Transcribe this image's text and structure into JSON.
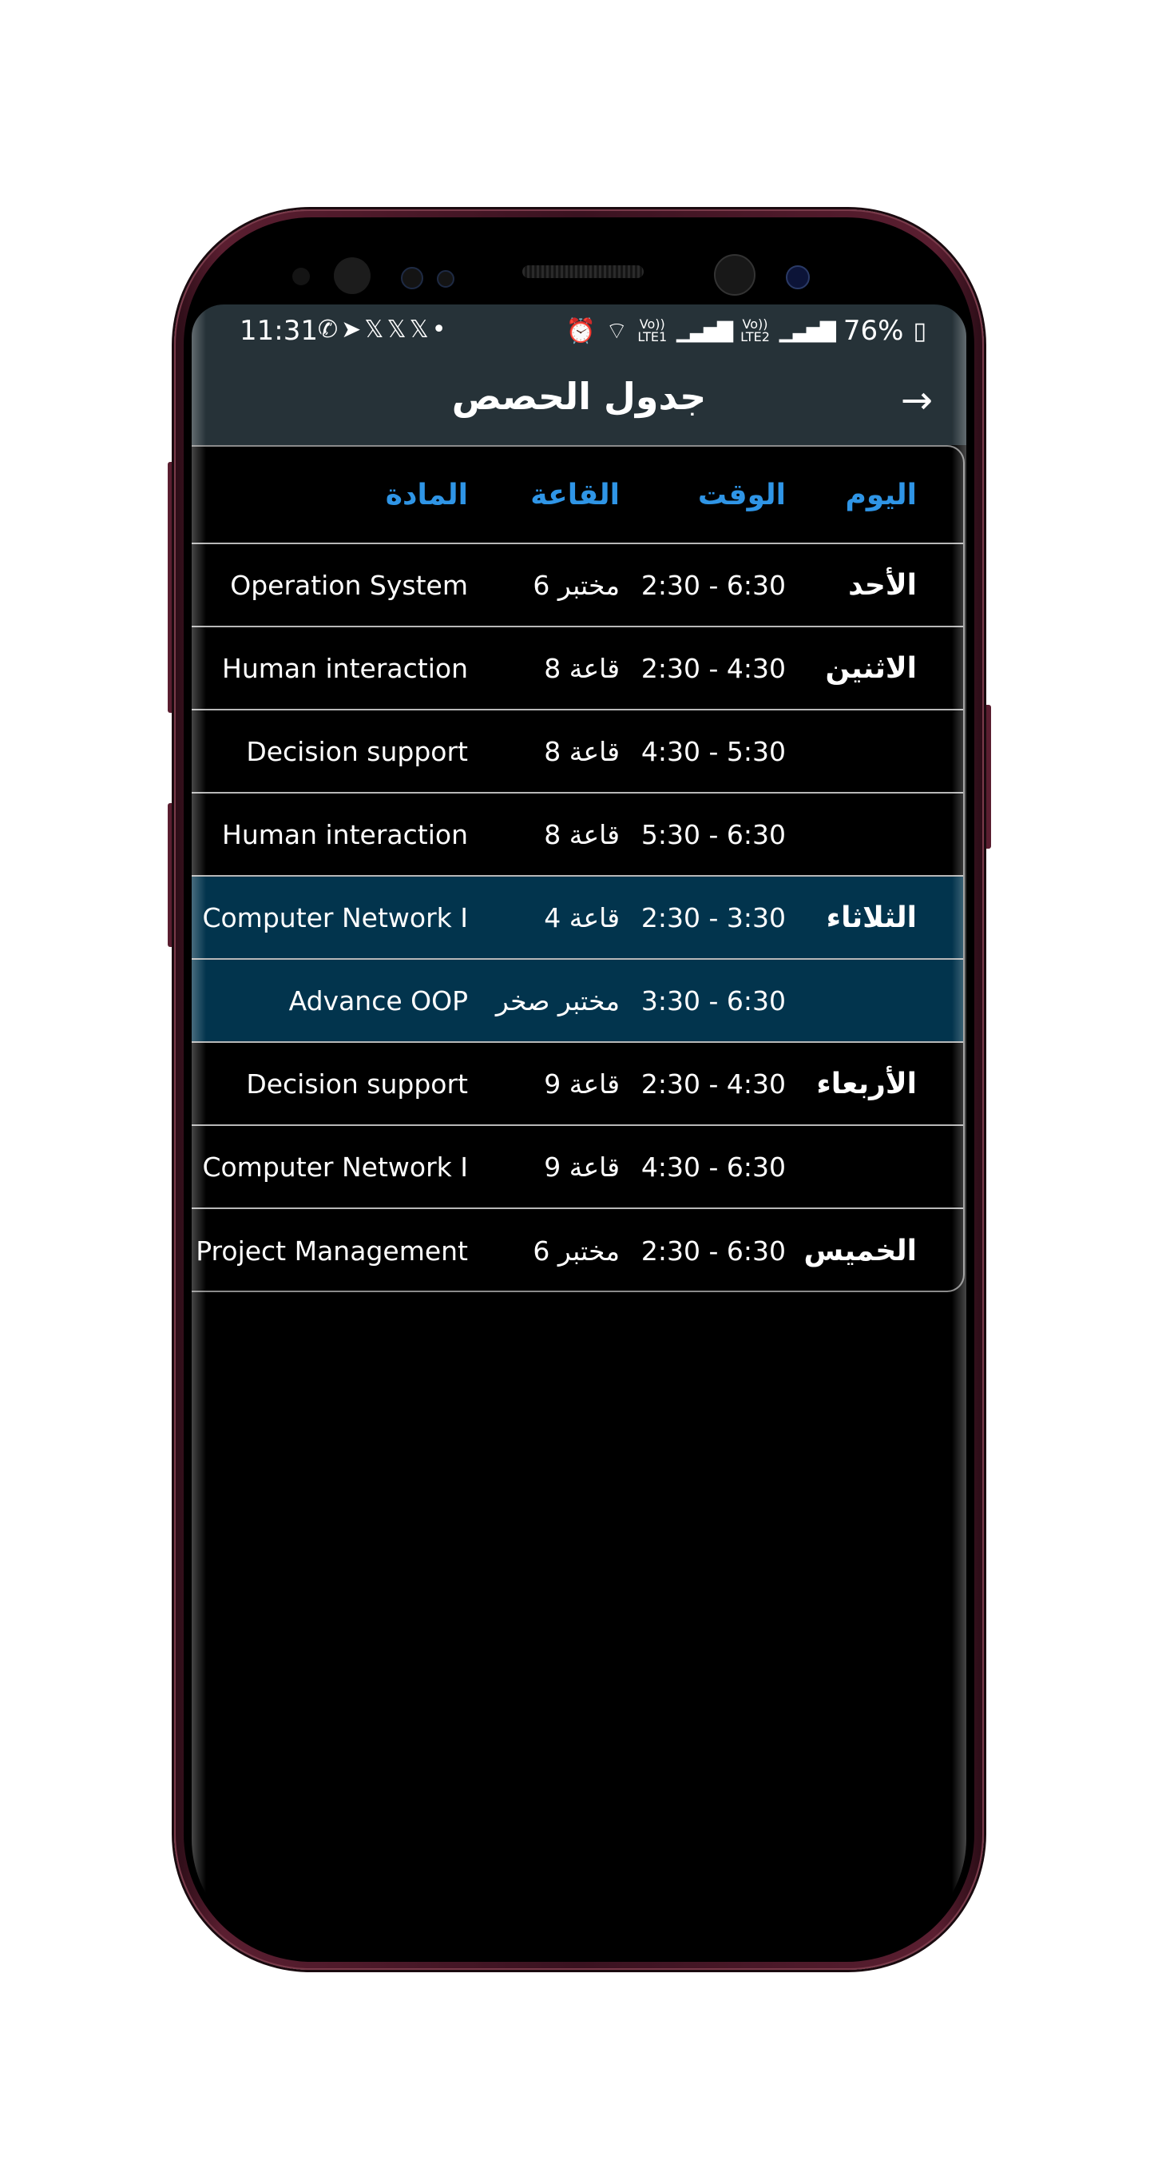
{
  "status_bar": {
    "time": "11:31",
    "notification_icons": [
      "whatsapp-icon",
      "telegram-icon",
      "x-icon",
      "x-icon",
      "x-icon",
      "dot-icon"
    ],
    "notification_glyphs": "✆➤𝕏𝕏𝕏•",
    "system_icons": [
      "alarm-icon",
      "wifi-icon",
      "lte1-signal-icon",
      "lte2-signal-icon",
      "battery-charging-icon"
    ],
    "alarm_glyph": "⏰",
    "wifi_glyph": "⌔",
    "sim1_label_top": "Vo))",
    "sim1_label_bottom": "LTE1",
    "sim2_label_top": "Vo))",
    "sim2_label_bottom": "LTE2",
    "signal_glyph": "▁▃▅▇",
    "battery": "76%",
    "battery_glyph": "▯"
  },
  "app_bar": {
    "title": "جدول الحصص",
    "back_icon": "arrow-right-icon",
    "back_glyph": "→"
  },
  "colors": {
    "app_bar_bg": "#263238",
    "header_text": "#2f95e6",
    "highlight_row_bg": "#02344d",
    "page_bg": "#000000"
  },
  "table": {
    "headers": {
      "day": "اليوم",
      "time": "الوقت",
      "hall": "القاعة",
      "subject": "المادة"
    },
    "rows": [
      {
        "day": "الأحد",
        "time": "2:30 - 6:30",
        "hall": "مختبر 6",
        "subject": "Operation System",
        "highlighted": false
      },
      {
        "day": "الاثنين",
        "time": "2:30 - 4:30",
        "hall": "قاعة 8",
        "subject": "Human interaction",
        "highlighted": false
      },
      {
        "day": "",
        "time": "4:30 - 5:30",
        "hall": "قاعة 8",
        "subject": "Decision support",
        "highlighted": false
      },
      {
        "day": "",
        "time": "5:30 - 6:30",
        "hall": "قاعة 8",
        "subject": "Human interaction",
        "highlighted": false
      },
      {
        "day": "الثلاثاء",
        "time": "2:30 - 3:30",
        "hall": "قاعة 4",
        "subject": "Computer Network I",
        "highlighted": true
      },
      {
        "day": "",
        "time": "3:30 - 6:30",
        "hall": "مختبر صخر",
        "subject": "Advance OOP",
        "highlighted": true
      },
      {
        "day": "الأربعاء",
        "time": "2:30 - 4:30",
        "hall": "قاعة 9",
        "subject": "Decision support",
        "highlighted": false
      },
      {
        "day": "",
        "time": "4:30 - 6:30",
        "hall": "قاعة 9",
        "subject": "Computer Network I",
        "highlighted": false
      },
      {
        "day": "الخميس",
        "time": "2:30 - 6:30",
        "hall": "مختبر 6",
        "subject": "Project Management",
        "highlighted": false
      }
    ]
  }
}
